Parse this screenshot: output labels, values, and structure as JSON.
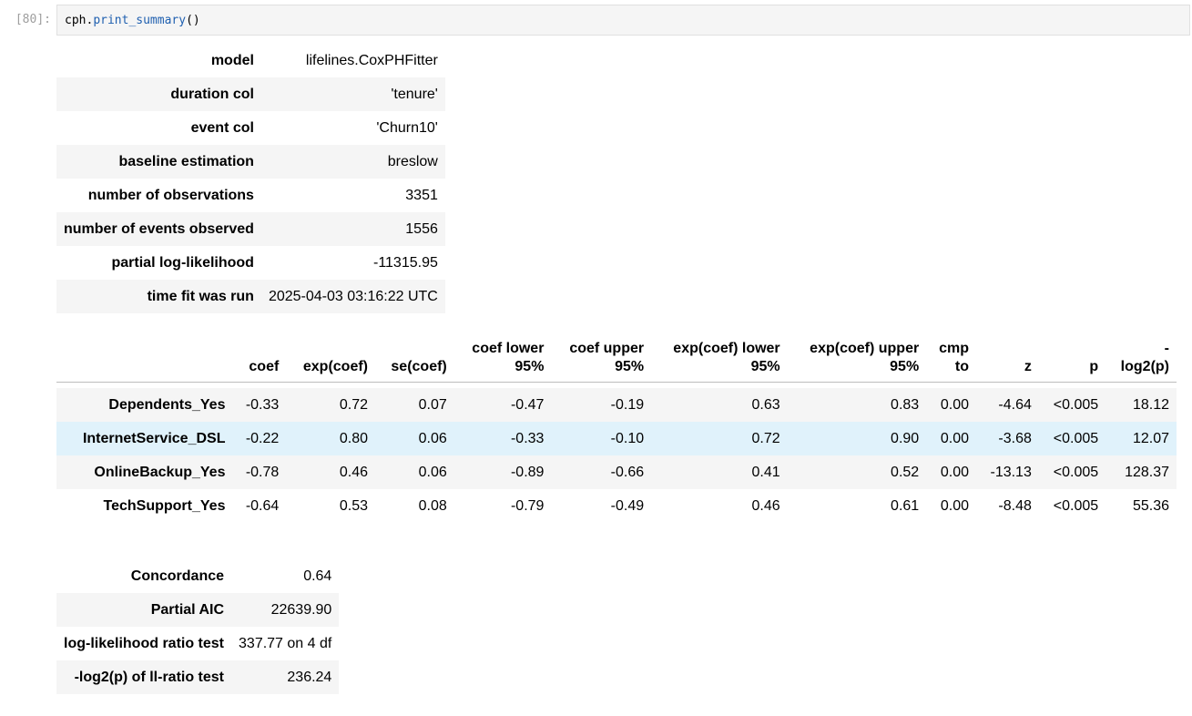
{
  "cell": {
    "prompt": "[80]:",
    "code_obj": "cph",
    "code_fn": "print_summary",
    "code_parens": "()"
  },
  "meta": [
    {
      "label": "model",
      "value": "lifelines.CoxPHFitter"
    },
    {
      "label": "duration col",
      "value": "'tenure'"
    },
    {
      "label": "event col",
      "value": "'Churn10'"
    },
    {
      "label": "baseline estimation",
      "value": "breslow"
    },
    {
      "label": "number of observations",
      "value": "3351"
    },
    {
      "label": "number of events observed",
      "value": "1556"
    },
    {
      "label": "partial log-likelihood",
      "value": "-11315.95"
    },
    {
      "label": "time fit was run",
      "value": "2025-04-03 03:16:22 UTC"
    }
  ],
  "coef_table": {
    "headers": [
      {
        "l1": "",
        "l2": "coef"
      },
      {
        "l1": "",
        "l2": "exp(coef)"
      },
      {
        "l1": "",
        "l2": "se(coef)"
      },
      {
        "l1": "coef lower",
        "l2": "95%"
      },
      {
        "l1": "coef upper",
        "l2": "95%"
      },
      {
        "l1": "exp(coef) lower",
        "l2": "95%"
      },
      {
        "l1": "exp(coef) upper",
        "l2": "95%"
      },
      {
        "l1": "cmp",
        "l2": "to"
      },
      {
        "l1": "",
        "l2": "z"
      },
      {
        "l1": "",
        "l2": "p"
      },
      {
        "l1": "-",
        "l2": "log2(p)"
      }
    ],
    "rows": [
      {
        "covariate": "Dependents_Yes",
        "cells": [
          "-0.33",
          "0.72",
          "0.07",
          "-0.47",
          "-0.19",
          "0.63",
          "0.83",
          "0.00",
          "-4.64",
          "<0.005",
          "18.12"
        ]
      },
      {
        "covariate": "InternetService_DSL",
        "cells": [
          "-0.22",
          "0.80",
          "0.06",
          "-0.33",
          "-0.10",
          "0.72",
          "0.90",
          "0.00",
          "-3.68",
          "<0.005",
          "12.07"
        ]
      },
      {
        "covariate": "OnlineBackup_Yes",
        "cells": [
          "-0.78",
          "0.46",
          "0.06",
          "-0.89",
          "-0.66",
          "0.41",
          "0.52",
          "0.00",
          "-13.13",
          "<0.005",
          "128.37"
        ]
      },
      {
        "covariate": "TechSupport_Yes",
        "cells": [
          "-0.64",
          "0.53",
          "0.08",
          "-0.79",
          "-0.49",
          "0.46",
          "0.61",
          "0.00",
          "-8.48",
          "<0.005",
          "55.36"
        ]
      }
    ]
  },
  "stats": [
    {
      "label": "Concordance",
      "value": "0.64"
    },
    {
      "label": "Partial AIC",
      "value": "22639.90"
    },
    {
      "label": "log-likelihood ratio test",
      "value": "337.77 on 4 df"
    },
    {
      "label": "-log2(p) of ll-ratio test",
      "value": "236.24"
    }
  ]
}
